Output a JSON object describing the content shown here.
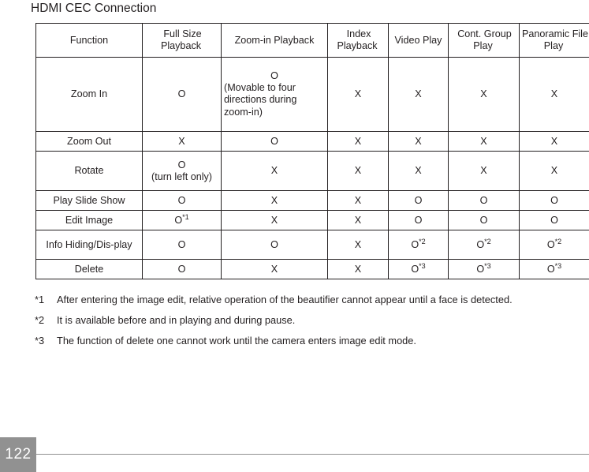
{
  "page": {
    "title": "HDMI CEC Connection",
    "number": "122"
  },
  "table": {
    "headers": [
      "Function",
      "Full Size Playback",
      "Zoom-in Playback",
      "Index Playback",
      "Video Play",
      "Cont. Group Play",
      "Panoramic File Play"
    ],
    "rows": [
      {
        "function": "Zoom In",
        "full_size": "O",
        "zoom_in": "O",
        "zoom_in_note": "(Movable to four directions during zoom-in)",
        "index": "X",
        "video": "X",
        "cont_group": "X",
        "panoramic": "X"
      },
      {
        "function": "Zoom Out",
        "full_size": "X",
        "zoom_in": "O",
        "index": "X",
        "video": "X",
        "cont_group": "X",
        "panoramic": "X"
      },
      {
        "function": "Rotate",
        "full_size": "O",
        "full_size_note": "(turn left only)",
        "zoom_in": "X",
        "index": "X",
        "video": "X",
        "cont_group": "X",
        "panoramic": "X"
      },
      {
        "function": "Play Slide Show",
        "full_size": "O",
        "zoom_in": "X",
        "index": "X",
        "video": "O",
        "cont_group": "O",
        "panoramic": "O"
      },
      {
        "function": "Edit Image",
        "full_size": "O",
        "full_size_sup": "*1",
        "zoom_in": "X",
        "index": "X",
        "video": "O",
        "cont_group": "O",
        "panoramic": "O"
      },
      {
        "function": "Info Hiding/Dis-play",
        "full_size": "O",
        "zoom_in": "O",
        "index": "X",
        "video": "O",
        "video_sup": "*2",
        "cont_group": "O",
        "cont_group_sup": "*2",
        "panoramic": "O",
        "panoramic_sup": "*2"
      },
      {
        "function": "Delete",
        "full_size": "O",
        "zoom_in": "X",
        "index": "X",
        "video": "O",
        "video_sup": "*3",
        "cont_group": "O",
        "cont_group_sup": "*3",
        "panoramic": "O",
        "panoramic_sup": "*3"
      }
    ]
  },
  "footnotes": [
    {
      "mark": "*1",
      "text": "After entering the image edit, relative operation of the beautifier cannot appear until a face is detected."
    },
    {
      "mark": "*2",
      "text": "It is available before and in playing and during pause."
    },
    {
      "mark": "*3",
      "text": "The function of delete one cannot work until the camera enters image edit mode."
    }
  ],
  "colors": {
    "text": "#231f20",
    "rule": "#919191",
    "badge_bg": "#919191",
    "badge_text": "#ffffff"
  }
}
